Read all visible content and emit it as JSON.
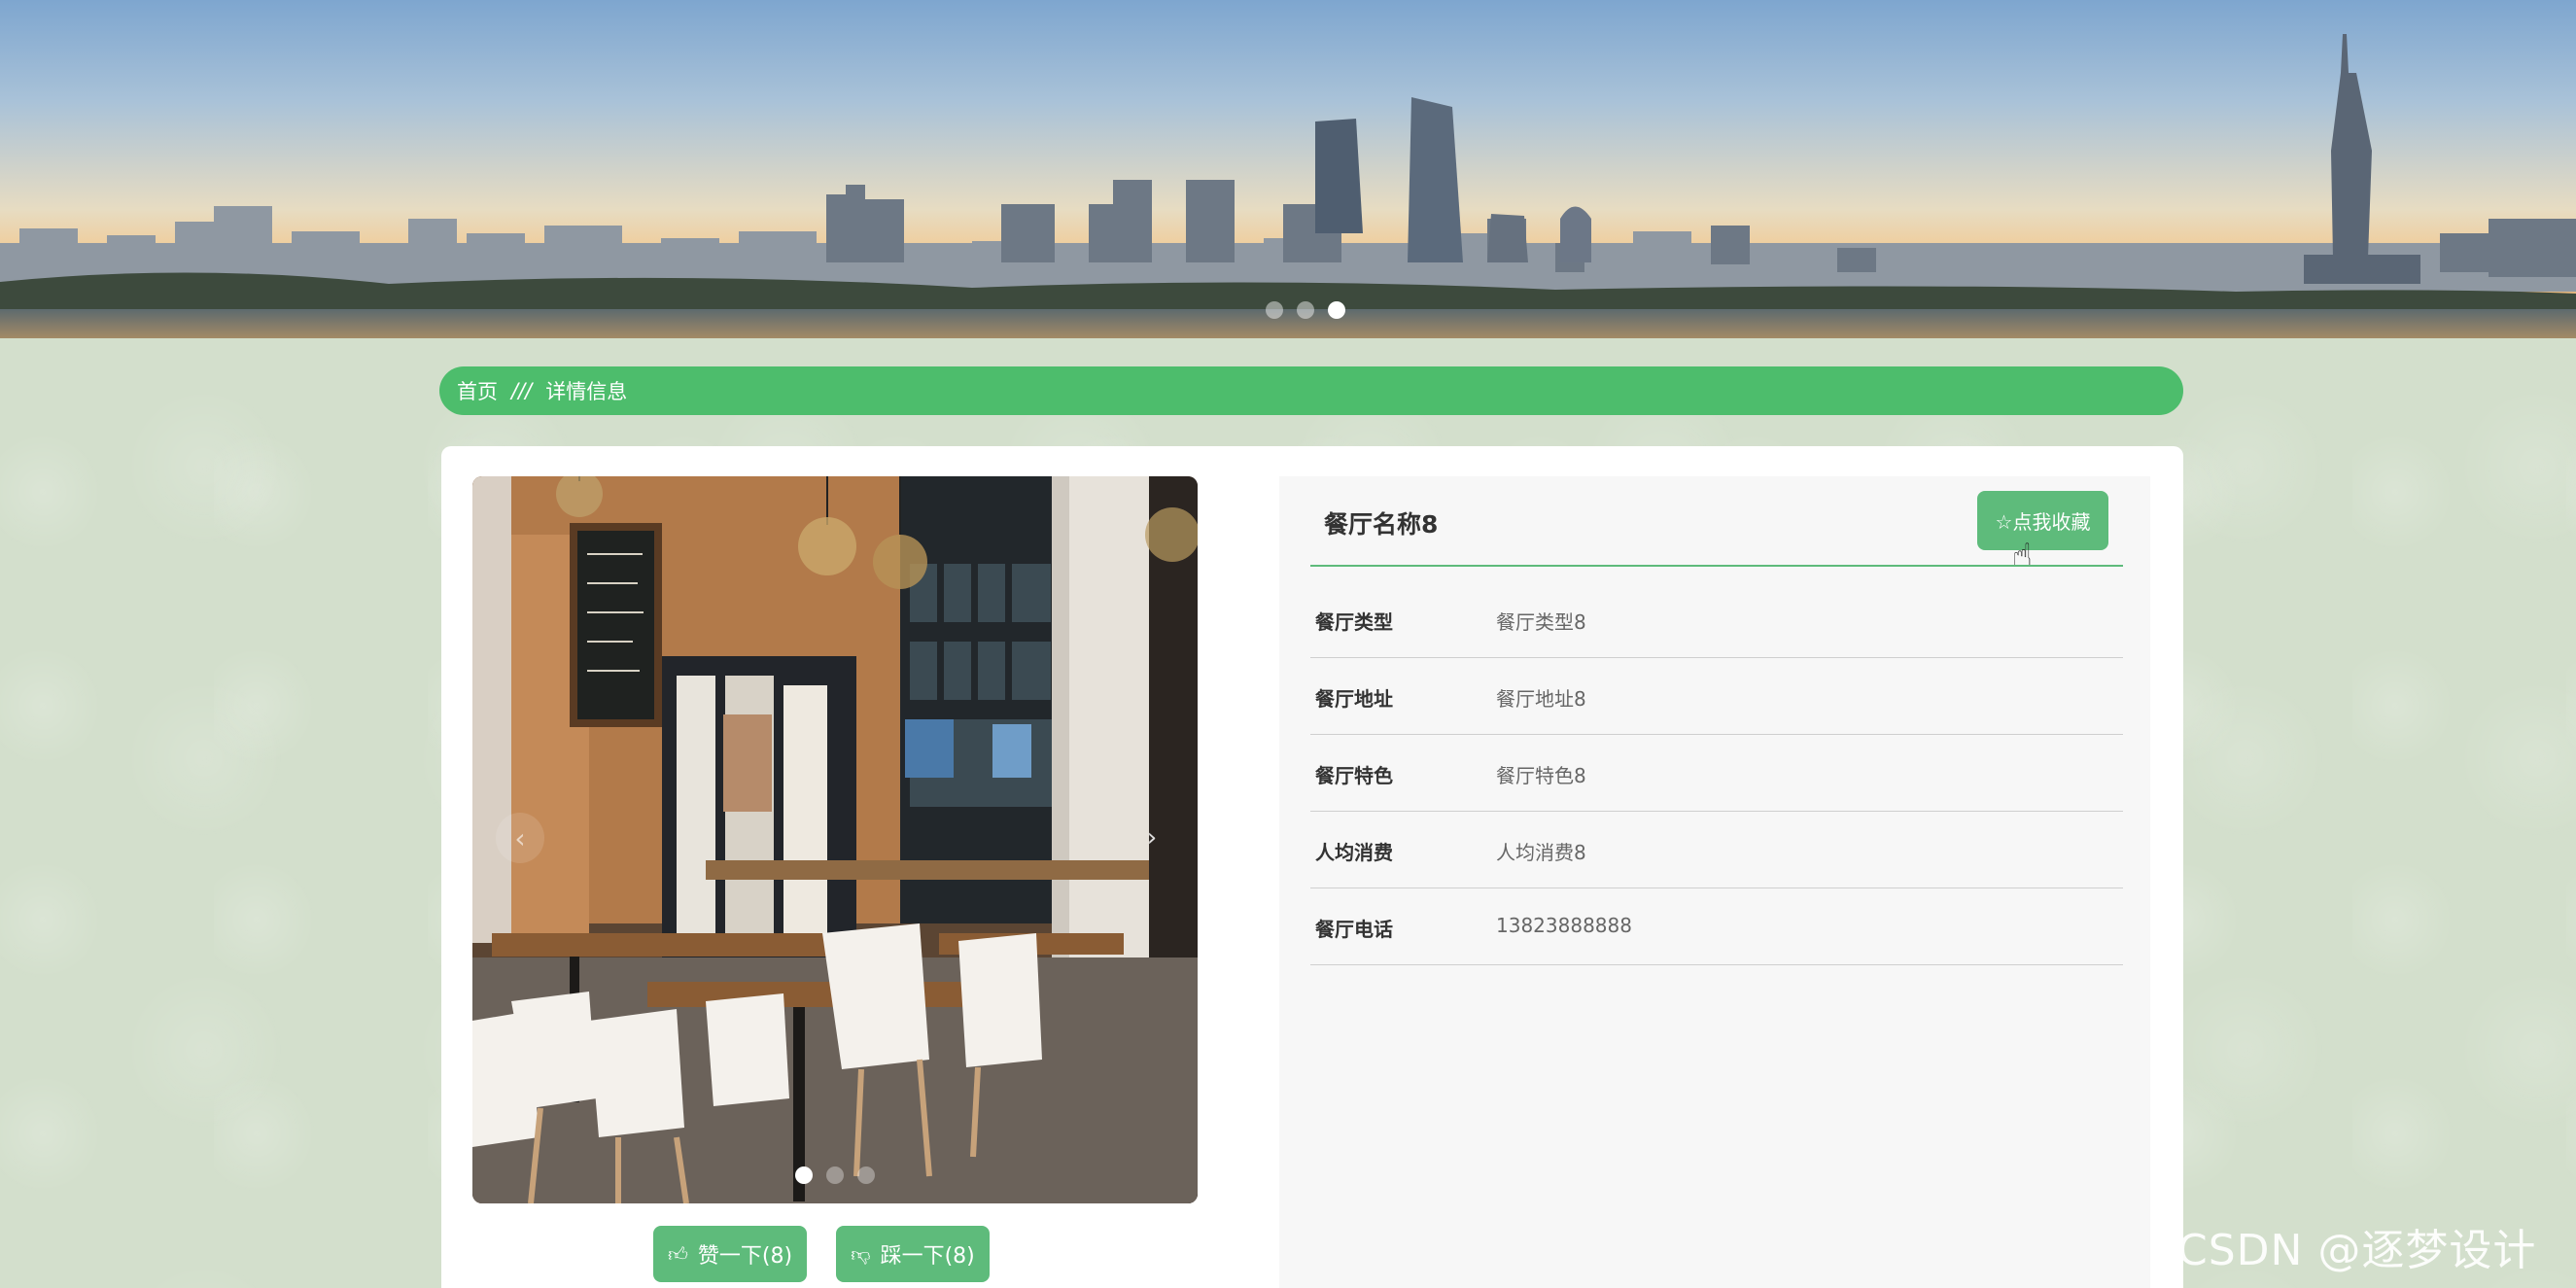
{
  "banner": {
    "slides": 3,
    "active_slide": 3
  },
  "breadcrumb": {
    "home": "首页",
    "separator": "///",
    "current": "详情信息"
  },
  "detail": {
    "title": "餐厅名称8",
    "favorite_label": "☆点我收藏",
    "fields": [
      {
        "label": "餐厅类型",
        "value": "餐厅类型8"
      },
      {
        "label": "餐厅地址",
        "value": "餐厅地址8"
      },
      {
        "label": "餐厅特色",
        "value": "餐厅特色8"
      },
      {
        "label": "人均消费",
        "value": "人均消费8"
      },
      {
        "label": "餐厅电话",
        "value": "13823888888"
      }
    ]
  },
  "photo": {
    "slides": 3,
    "active_slide": 1
  },
  "votes": {
    "like_label": "赞一下(8)",
    "dislike_label": "踩一下(8)"
  },
  "watermark": "CSDN @逐梦设计",
  "colors": {
    "accent": "#5ebb7b",
    "breadcrumb_bg": "#4dbd6c",
    "page_bg": "#d3dfcc"
  },
  "icons": {
    "like": "thumbs-up-icon",
    "dislike": "thumbs-down-icon",
    "cursor": "hand-pointer-icon"
  }
}
